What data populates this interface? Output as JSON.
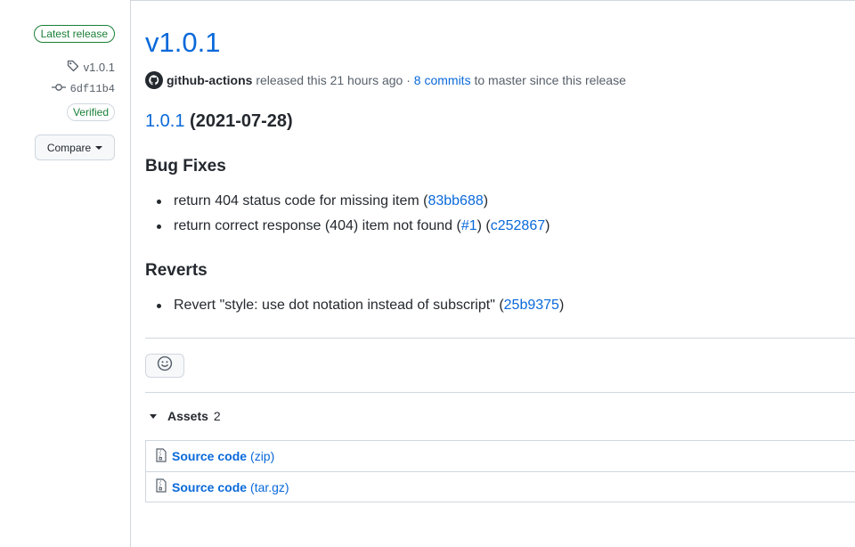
{
  "sidebar": {
    "latest_badge": "Latest release",
    "tag": "v1.0.1",
    "commit": "6df11b4",
    "verified": "Verified",
    "compare": "Compare"
  },
  "release": {
    "title": "v1.0.1",
    "author": "github-actions",
    "released_text": "released this 21 hours ago",
    "separator": "·",
    "commits_link": "8 commits",
    "commits_suffix": "to master since this release"
  },
  "notes": {
    "version_link": "1.0.1",
    "version_date": "(2021-07-28)",
    "sections": [
      {
        "heading": "Bug Fixes",
        "items": [
          {
            "text": "return 404 status code for missing item (",
            "links": [
              {
                "text": "83bb688"
              }
            ],
            "end": ")"
          },
          {
            "text": "return correct response (404) item not found (",
            "pr": "#1",
            "mid": ") (",
            "commit": "c252867",
            "end": ")"
          }
        ]
      },
      {
        "heading": "Reverts",
        "items": [
          {
            "text": "Revert \"style: use dot notation instead of subscript\" (",
            "commit": "25b9375",
            "end": ")"
          }
        ]
      }
    ]
  },
  "assets": {
    "label": "Assets",
    "count": "2",
    "items": [
      {
        "name": "Source code",
        "format": "(zip)"
      },
      {
        "name": "Source code",
        "format": "(tar.gz)"
      }
    ]
  },
  "icons": {
    "tag": "tag-icon",
    "commit": "git-commit-icon",
    "smiley": "smiley-icon",
    "zip": "file-zip-icon"
  },
  "colors": {
    "link": "#0969da",
    "success": "#1a7f37",
    "border": "#d0d7de"
  }
}
